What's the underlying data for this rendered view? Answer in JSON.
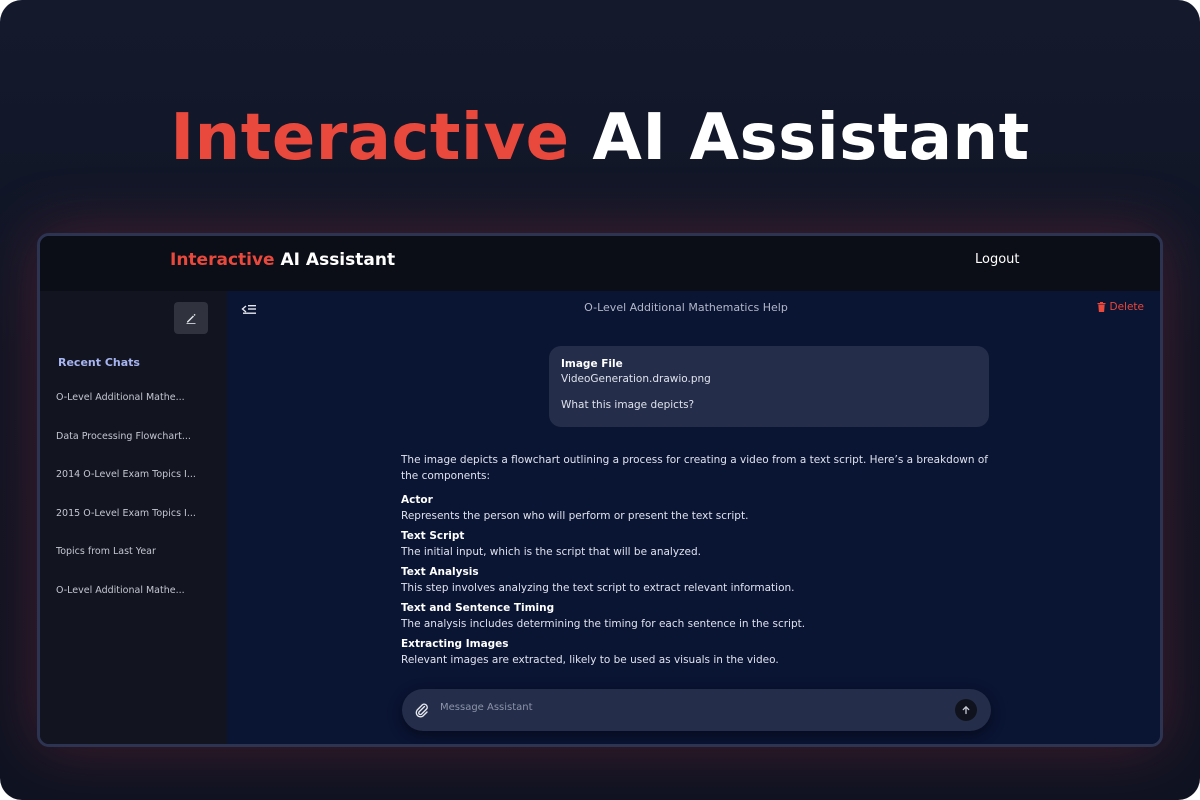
{
  "hero": {
    "title_accent": "Interactive",
    "title_rest": "AI Assistant"
  },
  "header": {
    "brand_accent": "Interactive",
    "brand_rest": "AI Assistant",
    "logout_label": "Logout"
  },
  "sidebar": {
    "new_chat_icon": "edit-icon",
    "recent_title": "Recent Chats",
    "items": [
      {
        "label": "O-Level Additional Mathe..."
      },
      {
        "label": "Data Processing Flowchart..."
      },
      {
        "label": "2014 O-Level Exam Topics I..."
      },
      {
        "label": "2015 O-Level Exam Topics I..."
      },
      {
        "label": "Topics from Last Year"
      },
      {
        "label": "O-Level Additional Mathe..."
      }
    ]
  },
  "chat": {
    "title": "O-Level Additional Mathematics Help",
    "delete_label": "Delete",
    "user_message": {
      "file_label": "Image File",
      "file_name": "VideoGeneration.drawio.png",
      "question": "What this image depicts?"
    },
    "assistant_reply": {
      "intro": "The image depicts a flowchart outlining a process for creating a video from a text script. Here’s a breakdown of the components:",
      "components": [
        {
          "title": "Actor",
          "desc": "Represents the person who will perform or present the text script."
        },
        {
          "title": "Text Script",
          "desc": "The initial input, which is the script that will be analyzed."
        },
        {
          "title": "Text Analysis",
          "desc": "This step involves analyzing the text script to extract relevant information."
        },
        {
          "title": "Text and Sentence Timing",
          "desc": "The analysis includes determining the timing for each sentence in the script."
        },
        {
          "title": "Extracting Images",
          "desc": "Relevant images are extracted, likely to be used as visuals in the video."
        }
      ]
    }
  },
  "composer": {
    "placeholder": "Message Assistant",
    "value": ""
  },
  "colors": {
    "accent_red": "#e8493c",
    "recent_title": "#a7b5f0",
    "main_bg": "#0a1433",
    "bubble_bg": "#242d49"
  }
}
